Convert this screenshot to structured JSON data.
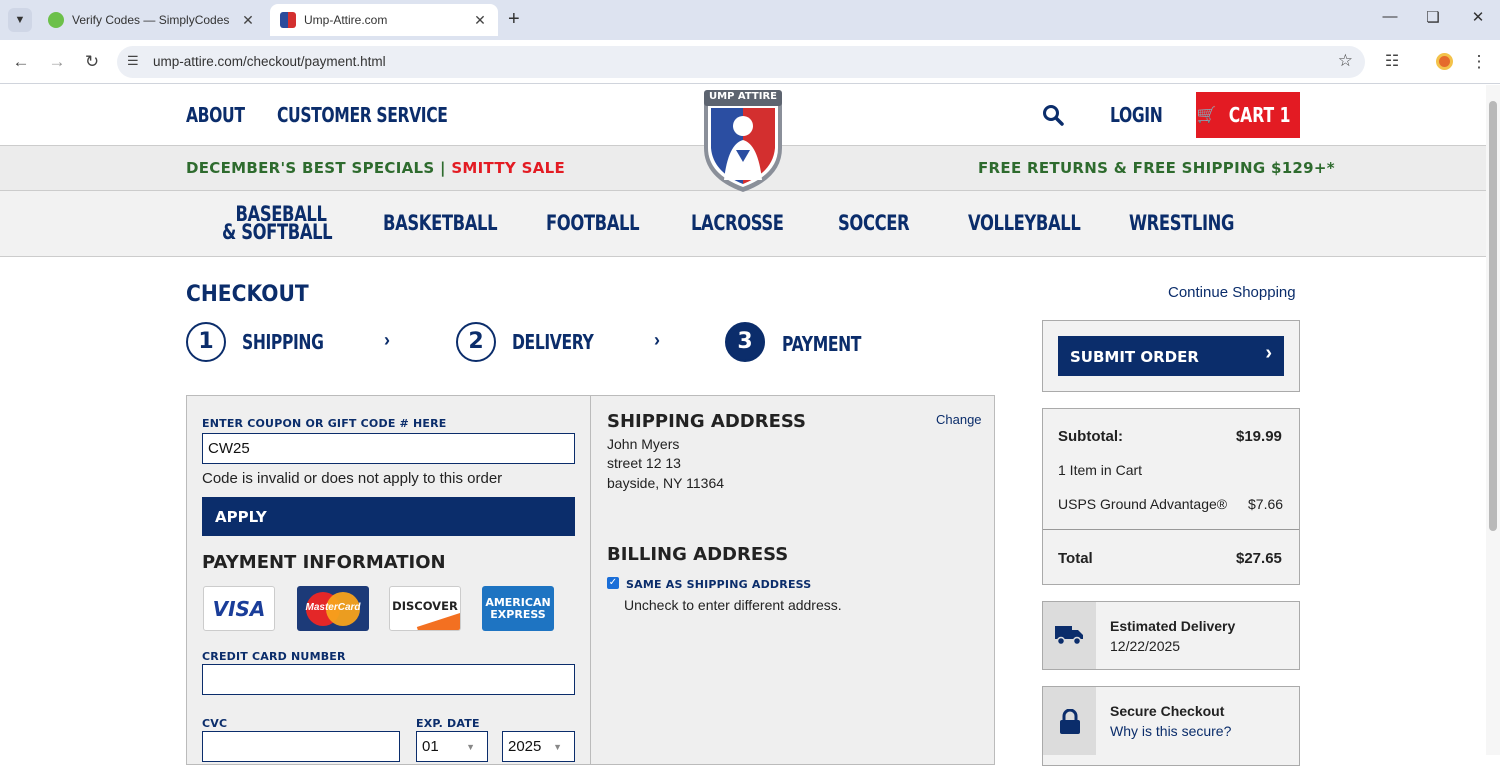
{
  "browser": {
    "tabs": [
      {
        "title": "Verify Codes — SimplyCodes",
        "active": false
      },
      {
        "title": "Ump-Attire.com",
        "active": true
      }
    ],
    "url": "ump-attire.com/checkout/payment.html"
  },
  "site": {
    "logo_text": "UMP ATTIRE",
    "topnav": {
      "about": "ABOUT",
      "customer_service": "CUSTOMER SERVICE",
      "login": "LOGIN",
      "cart": "CART 1"
    },
    "promo": {
      "left": "DECEMBER'S BEST SPECIALS |",
      "sale": "SMITTY SALE",
      "right": "FREE RETURNS & FREE SHIPPING $129+*"
    },
    "categories": [
      "BASEBALL",
      "& SOFTBALL",
      "BASKETBALL",
      "FOOTBALL",
      "LACROSSE",
      "SOCCER",
      "VOLLEYBALL",
      "WRESTLING"
    ]
  },
  "checkout": {
    "title": "CHECKOUT",
    "continue": "Continue Shopping",
    "steps": [
      {
        "num": "1",
        "label": "SHIPPING"
      },
      {
        "num": "2",
        "label": "DELIVERY"
      },
      {
        "num": "3",
        "label": "PAYMENT"
      }
    ],
    "coupon": {
      "label": "ENTER COUPON OR GIFT CODE # HERE",
      "value": "CW25",
      "message": "Code is invalid or does not apply to this order",
      "apply": "APPLY"
    },
    "payment": {
      "heading": "PAYMENT INFORMATION",
      "cards": [
        "VISA",
        "MasterCard",
        "DISCOVER",
        "AMERICAN",
        "EXPRESS"
      ],
      "cc_label": "CREDIT CARD NUMBER",
      "cvc_label": "CVC",
      "exp_label": "EXP. DATE",
      "exp_month": "01",
      "exp_year": "2025"
    },
    "shipping": {
      "heading": "SHIPPING ADDRESS",
      "change": "Change",
      "name": "John Myers",
      "street": "street 12 13",
      "city": "bayside, NY 11364"
    },
    "billing": {
      "heading": "BILLING ADDRESS",
      "same_label": "SAME AS SHIPPING ADDRESS",
      "same_checked": true,
      "hint": "Uncheck to enter different address."
    },
    "summary": {
      "submit": "SUBMIT ORDER",
      "subtotal_label": "Subtotal:",
      "subtotal": "$19.99",
      "items": "1 Item in Cart",
      "shipping_label": "USPS Ground Advantage®",
      "shipping": "$7.66",
      "total_label": "Total",
      "total": "$27.65",
      "est_label": "Estimated Delivery",
      "est_date": "12/22/2025",
      "secure_label": "Secure Checkout",
      "secure_link": "Why is this secure?"
    }
  },
  "colors": {
    "navy": "#0b2d6b",
    "red": "#e31b23",
    "green": "#2e6b2e"
  }
}
